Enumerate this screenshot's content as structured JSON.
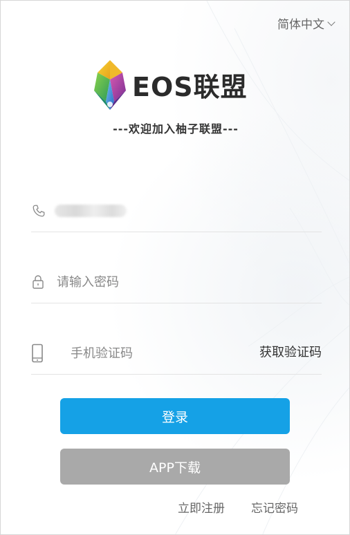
{
  "language": {
    "selected": "简体中文"
  },
  "logo": {
    "brand": "EOS联盟",
    "tagline": "---欢迎加入柚子联盟---"
  },
  "form": {
    "password_placeholder": "请输入密码",
    "code_placeholder": "手机验证码",
    "get_code_label": "获取验证码"
  },
  "buttons": {
    "login_label": "登录",
    "app_label": "APP下载"
  },
  "links": {
    "register_label": "立即注册",
    "forgot_label": "忘记密码"
  },
  "icons": {
    "phone": "phone-icon",
    "lock": "lock-icon",
    "mobile": "mobile-icon",
    "chevron": "chevron-down-icon",
    "logo": "crystal-logo-icon"
  },
  "colors": {
    "primary_button": "#15a1e6",
    "secondary_button": "#a9a9a9"
  }
}
